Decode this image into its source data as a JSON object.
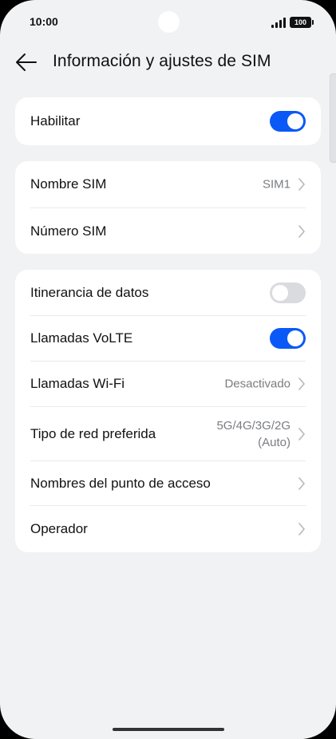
{
  "status_bar": {
    "time": "10:00",
    "battery": "100"
  },
  "header": {
    "title": "Información y ajustes de SIM",
    "back_icon": "arrow-left-icon"
  },
  "groups": [
    {
      "rows": [
        {
          "label": "Habilitar",
          "type": "toggle",
          "state": "on"
        }
      ]
    },
    {
      "rows": [
        {
          "label": "Nombre SIM",
          "type": "link",
          "value": "SIM1"
        },
        {
          "label": "Número SIM",
          "type": "link",
          "value": ""
        }
      ]
    },
    {
      "rows": [
        {
          "label": "Itinerancia de datos",
          "type": "toggle",
          "state": "off"
        },
        {
          "label": "Llamadas VoLTE",
          "type": "toggle",
          "state": "on"
        },
        {
          "label": "Llamadas Wi-Fi",
          "type": "link",
          "value": "Desactivado"
        },
        {
          "label": "Tipo de red preferida",
          "type": "link",
          "value_line1": "5G/4G/3G/2G",
          "value_line2": "(Auto)"
        },
        {
          "label": "Nombres del punto de acceso",
          "type": "link",
          "value": ""
        },
        {
          "label": "Operador",
          "type": "link",
          "value": ""
        }
      ]
    }
  ],
  "colors": {
    "accent": "#0a59f7",
    "background": "#f1f2f4",
    "toggle_off": "#dadbde"
  }
}
